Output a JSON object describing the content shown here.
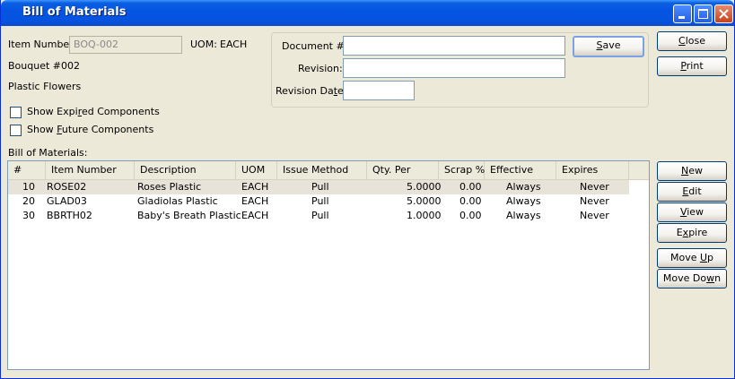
{
  "window": {
    "title": "Bill of Materials"
  },
  "item": {
    "number_label": "Item Number:",
    "number_value": "BOQ-002",
    "uom_label": "UOM:",
    "uom_value": "EACH",
    "description1": "Bouquet #002",
    "description2": "Plastic Flowers"
  },
  "options": {
    "show_expired": {
      "label_pre": "Show Expi",
      "label_u": "r",
      "label_post": "ed Components",
      "checked": false
    },
    "show_future": {
      "label_pre": "Show ",
      "label_u": "F",
      "label_post": "uture Components",
      "checked": false
    }
  },
  "document": {
    "doc_label": "Document #:",
    "doc_value": "",
    "revision_label": "Revision:",
    "revision_value": "",
    "revdate_label_pre": "Revision Da",
    "revdate_label_u": "t",
    "revdate_label_post": "e:",
    "revdate_value": ""
  },
  "buttons": {
    "save": {
      "u": "S",
      "rest": "ave"
    },
    "close": {
      "pre": "",
      "u": "C",
      "rest": "lose"
    },
    "print": {
      "pre": "",
      "u": "P",
      "rest": "rint"
    },
    "new": {
      "pre": "",
      "u": "N",
      "rest": "ew"
    },
    "edit": {
      "pre": "",
      "u": "E",
      "rest": "dit"
    },
    "view": {
      "pre": "",
      "u": "V",
      "rest": "iew"
    },
    "expire": {
      "pre": "E",
      "u": "x",
      "rest": "pire"
    },
    "move_up": {
      "pre": "Move ",
      "u": "U",
      "rest": "p"
    },
    "move_down": {
      "pre": "Move Do",
      "u": "w",
      "rest": "n"
    }
  },
  "grid": {
    "label": "Bill of Materials:",
    "columns": [
      "#",
      "Item Number",
      "Description",
      "UOM",
      "Issue Method",
      "Qty. Per",
      "Scrap %",
      "Effective",
      "Expires"
    ],
    "rows": [
      {
        "num": "10",
        "item": "ROSE02",
        "desc": "Roses Plastic",
        "uom": "EACH",
        "method": "Pull",
        "qty": "5.0000",
        "scrap": "0.00",
        "effective": "Always",
        "expires": "Never"
      },
      {
        "num": "20",
        "item": "GLAD03",
        "desc": "Gladiolas Plastic",
        "uom": "EACH",
        "method": "Pull",
        "qty": "5.0000",
        "scrap": "0.00",
        "effective": "Always",
        "expires": "Never"
      },
      {
        "num": "30",
        "item": "BBRTH02",
        "desc": "Baby's Breath Plastic",
        "uom": "EACH",
        "method": "Pull",
        "qty": "1.0000",
        "scrap": "0.00",
        "effective": "Always",
        "expires": "Never"
      }
    ]
  },
  "colors": {
    "titlebar": "#0554e3",
    "face": "#ece9d8",
    "field_border": "#7f9db9"
  }
}
